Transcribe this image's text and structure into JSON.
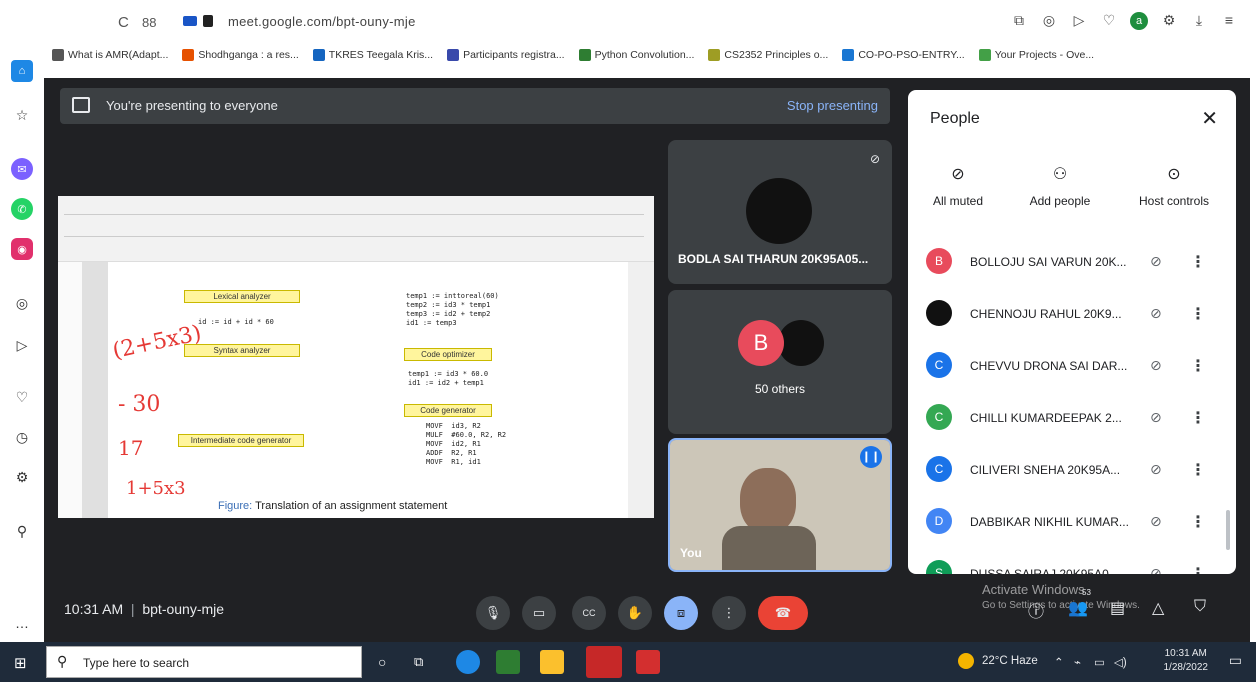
{
  "browser": {
    "url": "meet.google.com/bpt-ouny-mje",
    "bookmarks": [
      {
        "label": "What is AMR(Adapt...",
        "color": "#555555"
      },
      {
        "label": "Shodhganga : a res...",
        "color": "#e65100"
      },
      {
        "label": "TKRES Teegala Kris...",
        "color": "#1565c0"
      },
      {
        "label": "Participants registra...",
        "color": "#3949ab"
      },
      {
        "label": "Python Convolution...",
        "color": "#2e7d32"
      },
      {
        "label": "CS2352 Principles o...",
        "color": "#9e9d24"
      },
      {
        "label": "CO-PO-PSO-ENTRY...",
        "color": "#1976d2"
      },
      {
        "label": "Your Projects - Ove...",
        "color": "#43a047"
      }
    ]
  },
  "presenting": {
    "message": "You're presenting to everyone",
    "stop_label": "Stop presenting"
  },
  "slide": {
    "caption_label": "Figure:",
    "caption_text": "Translation of an assignment statement",
    "boxes": [
      "Lexical analyzer",
      "Syntax analyzer",
      "Intermediate code generator",
      "Code optimizer",
      "Code generator"
    ],
    "code_top": "temp1 := inttoreal(60)\ntemp2 := id3 * temp1\ntemp3 := id2 + temp2\nid1 := temp3",
    "code_mid": "temp1 := id3 * 60.0\nid1 := id2 + temp1",
    "code_bottom": "MOVF  id3, R2\nMULF  #60.0, R2, R2\nMOVF  id2, R1\nADDF  R2, R1\nMOVF  R1, id1",
    "lex_output": "id := id + id * 60",
    "ink": {
      "a": "(2+5x3)",
      "b": "- 30",
      "c": "17",
      "d": "1+5x3"
    }
  },
  "tiles": {
    "tile1_name": "BODLA SAI THARUN 20K95A05...",
    "tile2_avatar": "B",
    "tile2_label": "50 others",
    "tile3_name": "You"
  },
  "people": {
    "title": "People",
    "actions": [
      {
        "label": "All muted"
      },
      {
        "label": "Add people"
      },
      {
        "label": "Host controls"
      }
    ],
    "list": [
      {
        "initial": "B",
        "name": "BOLLOJU SAI VARUN 20K...",
        "color": "#e84b5c"
      },
      {
        "initial": "",
        "name": "CHENNOJU RAHUL 20K9...",
        "color": "#111111"
      },
      {
        "initial": "C",
        "name": "CHEVVU DRONA SAI DAR...",
        "color": "#1a73e8"
      },
      {
        "initial": "C",
        "name": "CHILLI KUMARDEEPAK 2...",
        "color": "#34a853"
      },
      {
        "initial": "C",
        "name": "CILIVERI SNEHA 20K95A...",
        "color": "#1a73e8"
      },
      {
        "initial": "D",
        "name": "DABBIKAR NIKHIL KUMAR...",
        "color": "#4285f4"
      },
      {
        "initial": "S",
        "name": "DUSSA SAIRAJ 20K95A0...",
        "color": "#0f9d58"
      }
    ]
  },
  "bottom": {
    "time": "10:31 AM",
    "meeting_code": "bpt-ouny-mje",
    "participant_count": "53",
    "watermark_title": "Activate Windows",
    "watermark_sub": "Go to Settings to activate Windows."
  },
  "taskbar": {
    "search_placeholder": "Type here to search",
    "weather": "22°C  Haze",
    "clock_time": "10:31 AM",
    "clock_date": "1/28/2022"
  }
}
